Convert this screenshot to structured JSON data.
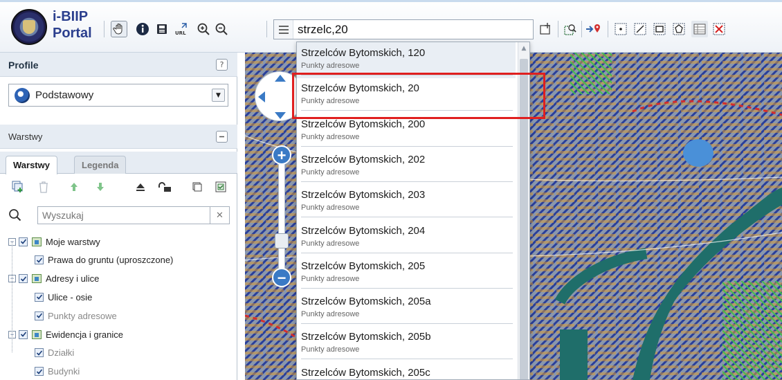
{
  "app": {
    "brand_line1": "i-BIIP",
    "brand_line2": "Portal"
  },
  "toolbar": {
    "search_value": "strzelc,20",
    "icons": [
      "pan-icon",
      "info-icon",
      "print-icon",
      "url-icon",
      "zoom-in-icon",
      "zoom-out-icon",
      "menu-icon",
      "add-window-icon",
      "zoom-extent-icon",
      "locate-icon",
      "select-point-icon",
      "select-line-icon",
      "select-rect-icon",
      "select-polygon-icon",
      "table-icon",
      "clear-selection-icon"
    ]
  },
  "panel": {
    "profile_title": "Profile",
    "profile_help": "?",
    "profile_value": "Podstawowy",
    "layers_title": "Warstwy",
    "tabs": [
      {
        "label": "Warstwy",
        "active": true
      },
      {
        "label": "Legenda",
        "active": false
      }
    ],
    "search_placeholder": "Wyszukaj",
    "tree": [
      {
        "label": "Moje warstwy",
        "level": 0,
        "group": true,
        "dim": false
      },
      {
        "label": "Prawa do gruntu (uproszczone)",
        "level": 1,
        "group": false,
        "dim": false
      },
      {
        "label": "Adresy i ulice",
        "level": 0,
        "group": true,
        "dim": false
      },
      {
        "label": "Ulice - osie",
        "level": 1,
        "group": false,
        "dim": false
      },
      {
        "label": "Punkty adresowe",
        "level": 1,
        "group": false,
        "dim": true
      },
      {
        "label": "Ewidencja i granice",
        "level": 0,
        "group": true,
        "dim": false
      },
      {
        "label": "Działki",
        "level": 1,
        "group": false,
        "dim": true
      },
      {
        "label": "Budynki",
        "level": 1,
        "group": false,
        "dim": true
      }
    ]
  },
  "dropdown": {
    "items": [
      {
        "name": "Strzelców Bytomskich, 120",
        "type": "Punkty adresowe"
      },
      {
        "name": "Strzelców Bytomskich, 20",
        "type": "Punkty adresowe"
      },
      {
        "name": "Strzelców Bytomskich, 200",
        "type": "Punkty adresowe"
      },
      {
        "name": "Strzelców Bytomskich, 202",
        "type": "Punkty adresowe"
      },
      {
        "name": "Strzelców Bytomskich, 203",
        "type": "Punkty adresowe"
      },
      {
        "name": "Strzelców Bytomskich, 204",
        "type": "Punkty adresowe"
      },
      {
        "name": "Strzelców Bytomskich, 205",
        "type": "Punkty adresowe"
      },
      {
        "name": "Strzelców Bytomskich, 205a",
        "type": "Punkty adresowe"
      },
      {
        "name": "Strzelców Bytomskich, 205b",
        "type": "Punkty adresowe"
      },
      {
        "name": "Strzelców Bytomskich, 205c",
        "type": ""
      }
    ],
    "highlighted_index": 1
  },
  "colors": {
    "highlight": "#e01f1f",
    "map_hatch": "#2a3f9a",
    "map_base": "#7c8aa1",
    "river": "#1f6e6a",
    "zoom_button": "#3a7ac5"
  }
}
